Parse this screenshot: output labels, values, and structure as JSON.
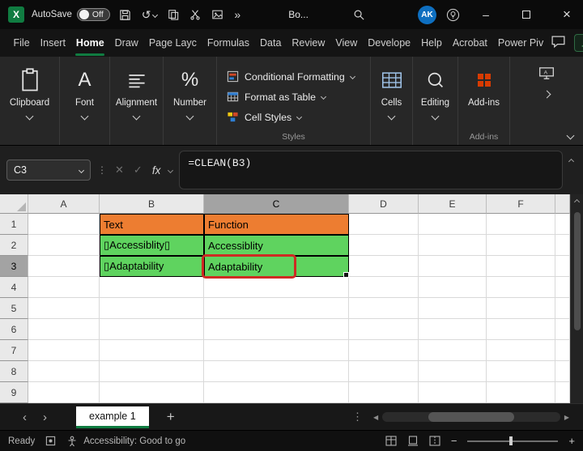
{
  "colors": {
    "accent_green": "#107C41",
    "cell_orange": "#ED7D31",
    "cell_green": "#5FD35F",
    "highlight_red": "#CE2B23",
    "avatar_blue": "#0E6FC0",
    "addins_orange": "#D83B01"
  },
  "icons": {
    "logo_letter": "X",
    "undo": "↺",
    "more_commands": "»",
    "vertical_dots": "⋮",
    "cancel": "✕",
    "enter": "✓",
    "minimize": "–",
    "close": "×",
    "add_sheet": "+",
    "prev_sheet": "‹",
    "next_sheet": "›",
    "scroll_left": "◀",
    "scroll_right": "▶",
    "zoom_out": "−",
    "zoom_in": "+"
  },
  "titlebar": {
    "autosave_label": "AutoSave",
    "autosave_state": "Off",
    "doc_title": "Bo...",
    "avatar_initials": "AK"
  },
  "menu": {
    "items": [
      "File",
      "Insert",
      "Home",
      "Draw",
      "Page Layc",
      "Formulas",
      "Data",
      "Review",
      "View",
      "Develope",
      "Help",
      "Acrobat",
      "Power Piv"
    ],
    "active_item": "Home"
  },
  "ribbon": {
    "clipboard_label": "Clipboard",
    "font_label": "Font",
    "font_glyph": "A",
    "number_glyph": "%",
    "alignment_label": "Alignment",
    "number_label": "Number",
    "styles": {
      "conditional_formatting": "Conditional Formatting",
      "format_as_table": "Format as Table",
      "cell_styles": "Cell Styles",
      "group_label": "Styles"
    },
    "cells_label": "Cells",
    "editing_label": "Editing",
    "addins_label": "Add-ins",
    "addins_group_label": "Add-ins"
  },
  "formula_bar": {
    "name_box": "C3",
    "fx_label": "fx",
    "formula": "=CLEAN(B3)"
  },
  "grid": {
    "columns": [
      "A",
      "B",
      "C",
      "D",
      "E",
      "F"
    ],
    "rows": [
      "1",
      "2",
      "3",
      "4",
      "5",
      "6",
      "7",
      "8",
      "9"
    ],
    "selected_cell": "C3",
    "cells": {
      "b1": "Text",
      "c1": "Function",
      "b2": "▯Accessiblity▯",
      "c2": "Accessiblity",
      "b3": "▯Adaptability",
      "c3": "Adaptability"
    }
  },
  "sheet_tabs": {
    "active_tab": "example 1"
  },
  "status_bar": {
    "ready": "Ready",
    "accessibility": "Accessibility: Good to go"
  }
}
